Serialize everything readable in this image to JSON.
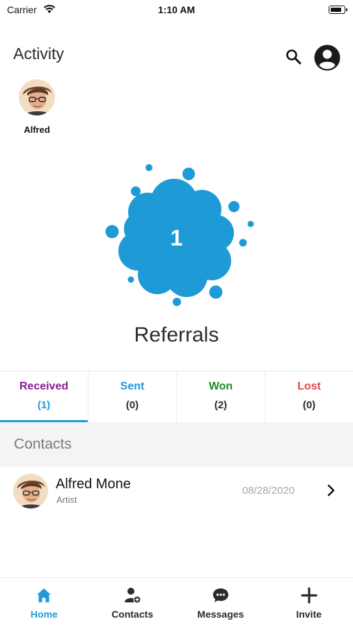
{
  "status_bar": {
    "carrier": "Carrier",
    "time": "1:10 AM"
  },
  "header": {
    "title": "Activity",
    "icons": [
      "search-icon",
      "profile-icon"
    ]
  },
  "user": {
    "name": "Alfred"
  },
  "referrals": {
    "count": "1",
    "title": "Referrals",
    "splat_color": "#1e9bd7"
  },
  "tabs": [
    {
      "label": "Received",
      "count": "(1)",
      "color": "#8b1a8f",
      "count_color": "#1e9bd7",
      "active": true
    },
    {
      "label": "Sent",
      "count": "(0)",
      "color": "#1e9bd7",
      "active": false
    },
    {
      "label": "Won",
      "count": "(2)",
      "color": "#1f8a2a",
      "active": false
    },
    {
      "label": "Lost",
      "count": "(0)",
      "color": "#e0464e",
      "active": false
    }
  ],
  "contacts": {
    "section_title": "Contacts",
    "items": [
      {
        "name": "Alfred Mone",
        "role": "Artist",
        "date": "08/28/2020"
      }
    ]
  },
  "bottom_nav": {
    "accent": "#1e9bd7",
    "items": [
      {
        "label": "Home",
        "icon": "home-icon",
        "active": true
      },
      {
        "label": "Contacts",
        "icon": "add-contact-icon",
        "active": false
      },
      {
        "label": "Messages",
        "icon": "chat-icon",
        "active": false
      },
      {
        "label": "Invite",
        "icon": "plus-icon",
        "active": false
      }
    ]
  }
}
